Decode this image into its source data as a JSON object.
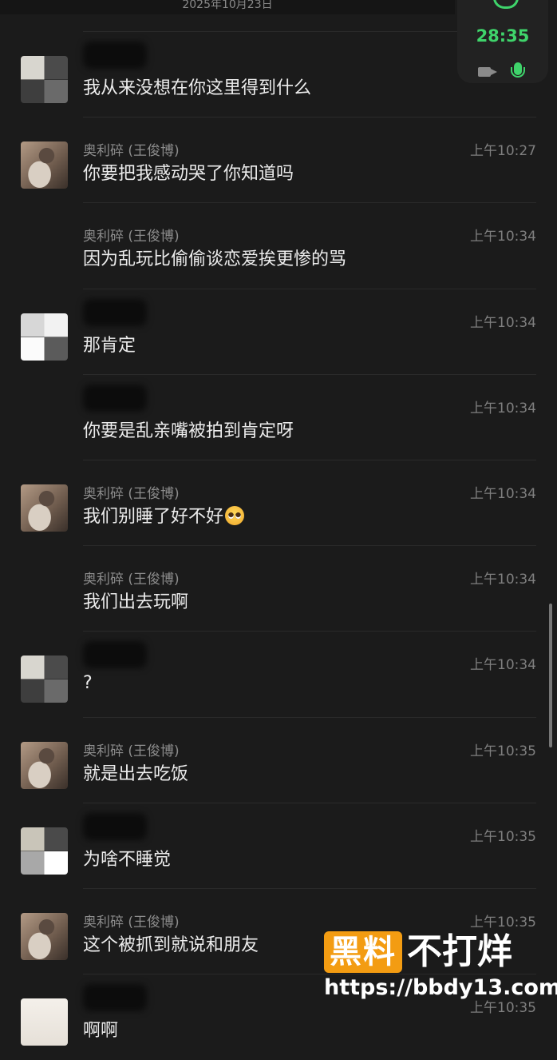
{
  "date_header": "2025年10月23日",
  "call": {
    "duration": "28:35"
  },
  "messages": [
    {
      "avatar": "blurred",
      "sender": "",
      "time": "",
      "text": "我从来没想在你这里得到什么"
    },
    {
      "avatar": "photo",
      "sender": "奥利碎 (王俊博)",
      "time": "上午10:27",
      "text": "你要把我感动哭了你知道吗"
    },
    {
      "avatar": "none",
      "sender": "奥利碎 (王俊博)",
      "time": "上午10:34",
      "text": "因为乱玩比偷偷谈恋爱挨更惨的骂"
    },
    {
      "avatar": "blurred2",
      "sender": "",
      "time": "上午10:34",
      "text": "那肯定"
    },
    {
      "avatar": "none",
      "sender": "",
      "time": "上午10:34",
      "text": "你要是乱亲嘴被拍到肯定呀"
    },
    {
      "avatar": "photo",
      "sender": "奥利碎 (王俊博)",
      "time": "上午10:34",
      "text": "我们别睡了好不好"
    },
    {
      "avatar": "none",
      "sender": "奥利碎 (王俊博)",
      "time": "上午10:34",
      "text": "我们出去玩啊"
    },
    {
      "avatar": "blurred",
      "sender": "",
      "time": "上午10:34",
      "text": "?"
    },
    {
      "avatar": "photo",
      "sender": "奥利碎 (王俊博)",
      "time": "上午10:35",
      "text": "就是出去吃饭"
    },
    {
      "avatar": "blurred3",
      "sender": "",
      "time": "上午10:35",
      "text": "为啥不睡觉"
    },
    {
      "avatar": "photo",
      "sender": "奥利碎 (王俊博)",
      "time": "上午10:35",
      "text": "这个被抓到就说和朋友"
    },
    {
      "avatar": "anime",
      "sender": "",
      "time": "上午10:35",
      "text": "啊啊"
    }
  ],
  "watermark": {
    "badge": "黑料",
    "title": "不打烊",
    "url": "https://bbdy13.com"
  },
  "colors": {
    "background": "#1b1b1b",
    "call_green": "#3fd46b",
    "watermark_orange": "#f39c12"
  }
}
